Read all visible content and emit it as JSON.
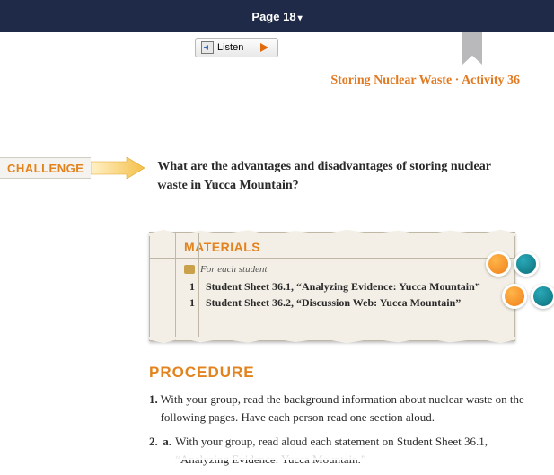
{
  "topbar": {
    "page_label": "Page 18"
  },
  "toolbar": {
    "listen_label": "Listen"
  },
  "header": {
    "topic": "Storing Nuclear Waste",
    "sep": " · ",
    "activity": "Activity 36"
  },
  "challenge": {
    "tag": "CHALLENGE",
    "text": "What are the advantages and disadvantages of storing nuclear waste in Yucca Mountain?"
  },
  "materials": {
    "heading": "MATERIALS",
    "subhead": "For each student",
    "items": [
      {
        "qty": "1",
        "text": "Student Sheet 36.1, “Analyzing Evidence: Yucca Mountain”"
      },
      {
        "qty": "1",
        "text": "Student Sheet 36.2, “Discussion Web: Yucca Mountain”"
      }
    ]
  },
  "procedure": {
    "heading": "PROCEDURE",
    "steps": [
      {
        "num": "1.",
        "text": "With your group, read the background information about nuclear waste on the following pages. Have each person read one section aloud."
      },
      {
        "num": "2.",
        "letter": "a.",
        "text": "With your group, read aloud each statement on Student Sheet 36.1, “Analyzing Evidence: Yucca Mountain.”"
      }
    ]
  }
}
